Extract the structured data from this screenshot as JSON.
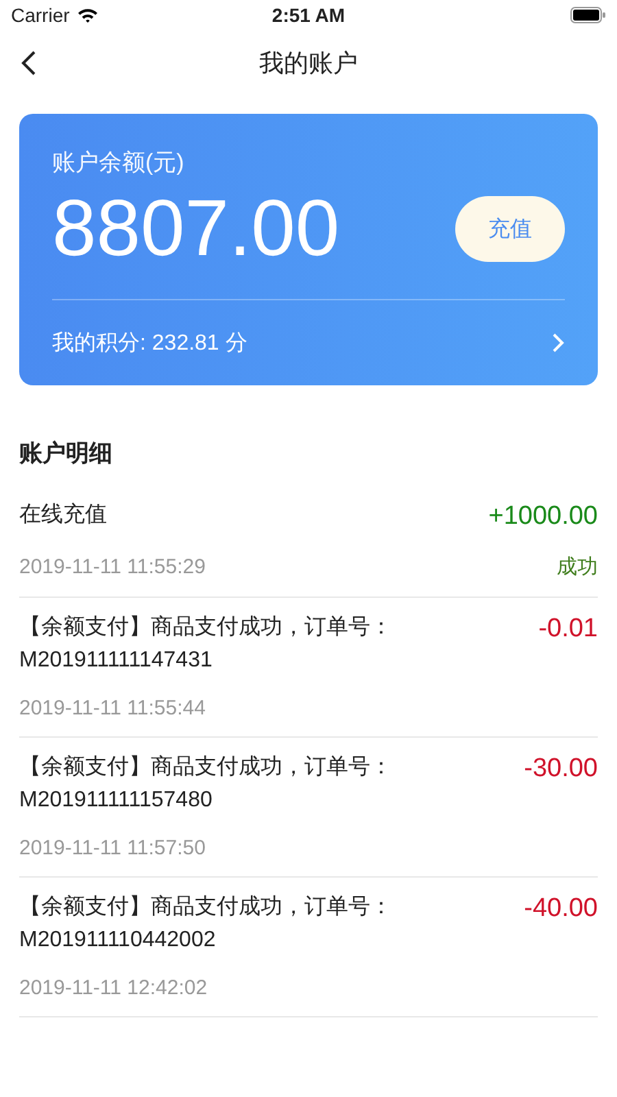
{
  "status_bar": {
    "carrier": "Carrier",
    "time": "2:51 AM"
  },
  "nav": {
    "title": "我的账户"
  },
  "balance_card": {
    "label": "账户余额(元)",
    "amount": "8807.00",
    "recharge_button": "充值",
    "points": "我的积分: 232.81 分"
  },
  "details": {
    "title": "账户明细",
    "transactions": [
      {
        "kind": "credit",
        "description": "在线充值",
        "amount": "+1000.00",
        "time": "2019-11-11 11:55:29",
        "status": "成功"
      },
      {
        "kind": "debit",
        "description": "【余额支付】商品支付成功，订单号：M201911111147431",
        "amount": "-0.01",
        "time": "2019-11-11 11:55:44"
      },
      {
        "kind": "debit",
        "description": "【余额支付】商品支付成功，订单号：M201911111157480",
        "amount": "-30.00",
        "time": "2019-11-11 11:57:50"
      },
      {
        "kind": "debit",
        "description": "【余额支付】商品支付成功，订单号：M201911110442002",
        "amount": "-40.00",
        "time": "2019-11-11 12:42:02"
      }
    ]
  }
}
